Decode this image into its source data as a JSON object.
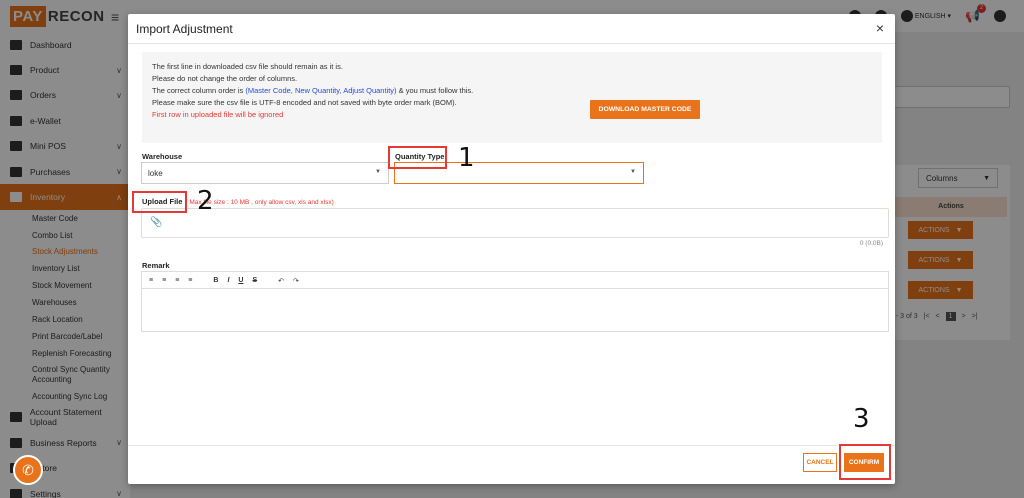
{
  "app": {
    "logo_pay": "PAY",
    "logo_recon": "RECON"
  },
  "sidebar": {
    "items": [
      {
        "label": "Dashboard",
        "icon": "chart-icon"
      },
      {
        "label": "Product",
        "icon": "box-icon",
        "chevron": "∨"
      },
      {
        "label": "Orders",
        "icon": "clipboard-icon",
        "chevron": "∨"
      },
      {
        "label": "e-Wallet",
        "icon": "wallet-icon"
      },
      {
        "label": "Mini POS",
        "icon": "pos-icon",
        "chevron": "∨"
      },
      {
        "label": "Purchases",
        "icon": "cart-icon",
        "chevron": "∨"
      },
      {
        "label": "Inventory",
        "icon": "inventory-icon",
        "chevron": "∧"
      }
    ],
    "inventory_sub": [
      "Master Code",
      "Combo List",
      "Stock Adjustments",
      "Inventory List",
      "Stock Movement",
      "Warehouses",
      "Rack Location",
      "Print Barcode/Label",
      "Replenish Forecasting",
      "Control Sync Quantity Accounting",
      "Accounting Sync Log"
    ],
    "bottom_items": [
      {
        "label": "Account Statement Upload",
        "icon": "upload-icon"
      },
      {
        "label": "Business Reports",
        "icon": "pie-chart-icon",
        "chevron": "∨"
      },
      {
        "label": "s Store",
        "icon": "store-icon"
      },
      {
        "label": "Settings",
        "icon": "gear-icon",
        "chevron": "∨"
      }
    ]
  },
  "topbar": {
    "language": "ENGLISH",
    "notification_count": "2"
  },
  "background": {
    "columns_label": "Columns",
    "actions_header": "Actions",
    "action_button": "ACTIONS",
    "pager_text": "1 - 3 of 3",
    "current_page": "1"
  },
  "modal": {
    "title": "Import Adjustment",
    "close": "×",
    "info": {
      "line1": "The first line in downloaded csv file should remain as it is.",
      "line2": "Please do not change the order of columns.",
      "line3_pre": "The correct column order is ",
      "line3_hl": "(Master Code, New Quantity, Adjust Quantity)",
      "line3_post": " & you must follow this.",
      "line4": "Please make sure the csv file is UTF-8 encoded and not saved with byte order mark (BOM).",
      "line5": "First row in uploaded file will be ignored"
    },
    "download_button": "DOWNLOAD MASTER CODE",
    "warehouse_label": "Warehouse",
    "warehouse_value": "loke",
    "quantity_type_label": "Quantity Type",
    "quantity_type_value": "",
    "upload_label": "Upload File",
    "upload_hint": "( Max file size : 10 MB , only allow csv, xls and xlsx)",
    "file_size": "0 (0.0B)",
    "remark_label": "Remark",
    "cancel_button": "CANCEL",
    "confirm_button": "CONFIRM"
  },
  "annotations": [
    "1",
    "2",
    "3"
  ],
  "colors": {
    "brand": "#e8731a",
    "annotation": "#e53935",
    "highlight_text": "#2a4ad4"
  }
}
